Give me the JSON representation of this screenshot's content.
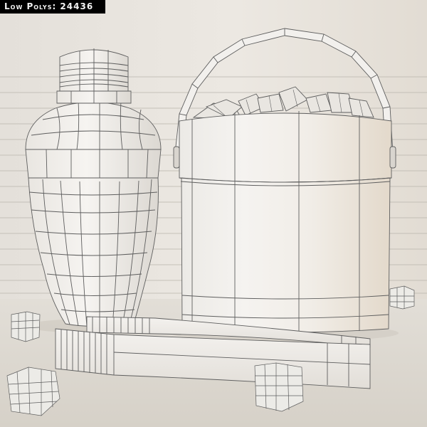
{
  "caption": "Low Polys: 24436",
  "scene": {
    "objects": [
      "cocktail-shaker",
      "ice-bucket",
      "ice-tongs",
      "ice-cubes"
    ],
    "colors": {
      "background": "#ece9e4",
      "wall": "#e7e3dd",
      "floor": "#dcd7cf",
      "model": "#f3f1ee",
      "wire": "#6a6a6a",
      "caption_bg": "#000000",
      "caption_text": "#f2f2f2"
    }
  }
}
